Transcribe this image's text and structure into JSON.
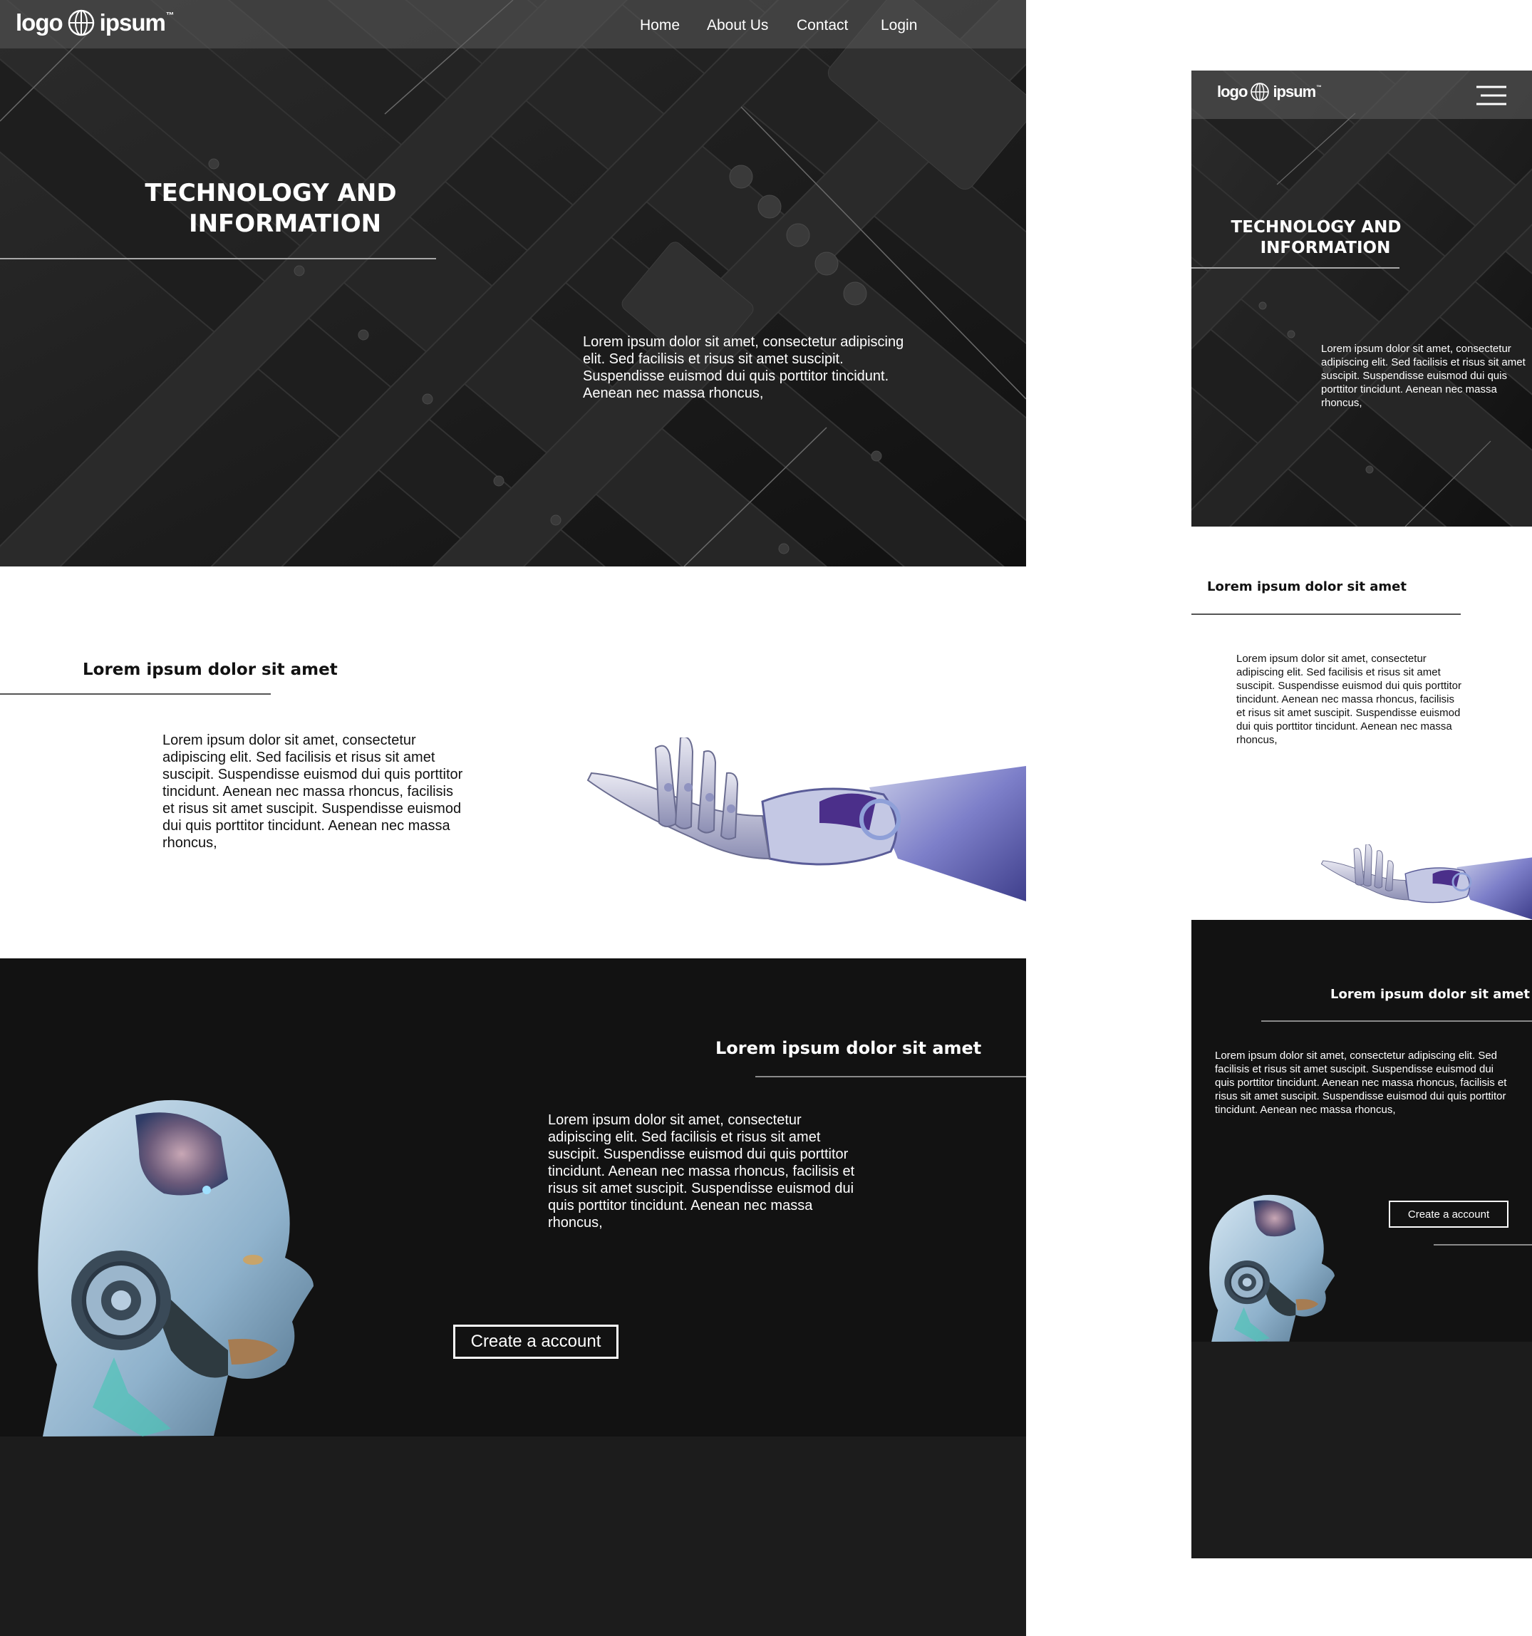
{
  "brand": {
    "logo_left": "logo",
    "logo_right": "ipsum"
  },
  "nav": {
    "items": [
      {
        "label": "Home"
      },
      {
        "label": "About Us"
      },
      {
        "label": "Contact"
      },
      {
        "label": "Login"
      }
    ]
  },
  "hero": {
    "title_line1": "TECHNOLOGY AND",
    "title_line2": "INFORMATION",
    "text": "Lorem ipsum dolor sit amet, consectetur adipiscing elit. Sed facilisis et risus sit amet suscipit. Suspendisse euismod dui quis porttitor tincidunt. Aenean nec massa rhoncus,"
  },
  "section2": {
    "heading": "Lorem ipsum dolor sit amet",
    "text": "Lorem ipsum dolor sit amet, consectetur adipiscing elit. Sed facilisis et risus sit amet suscipit. Suspendisse euismod dui quis porttitor tincidunt. Aenean nec massa rhoncus, facilisis et risus sit amet suscipit. Suspendisse euismod dui quis porttitor tincidunt. Aenean nec massa rhoncus,"
  },
  "section3": {
    "heading": "Lorem ipsum dolor sit amet",
    "text": "Lorem ipsum dolor sit amet, consectetur adipiscing elit. Sed facilisis et risus sit amet suscipit. Suspendisse euismod dui quis porttitor tincidunt. Aenean nec massa rhoncus, facilisis et risus sit amet suscipit. Suspendisse euismod dui quis porttitor tincidunt. Aenean nec massa rhoncus,",
    "cta_label": "Create a account"
  },
  "icons": {
    "logo_mark": "globe-icon",
    "mobile_menu": "hamburger-menu-icon"
  },
  "colors": {
    "hero_bg": "#1a1a1a",
    "dark_section": "#121212",
    "footer": "#1c1c1c",
    "accent_robot": "#6b6fd1"
  }
}
